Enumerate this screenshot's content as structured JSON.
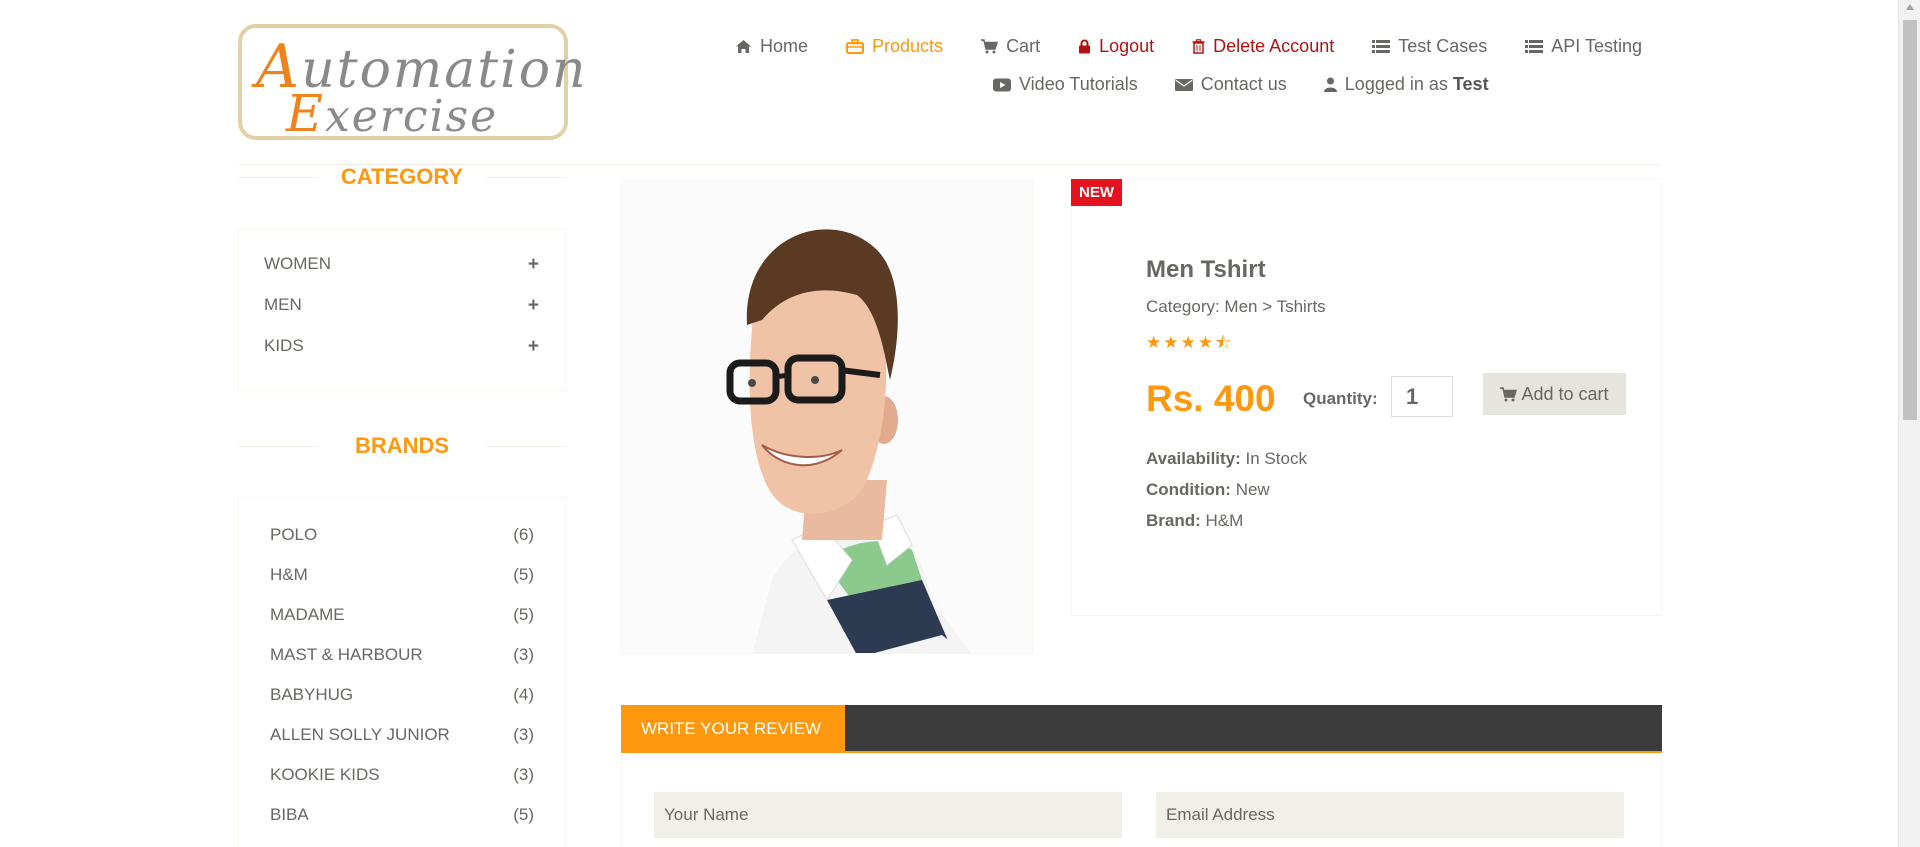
{
  "logo": {
    "line1_cap": "A",
    "line1_rest": "utomation",
    "line2_cap": "E",
    "line2_rest": "xercise"
  },
  "nav": {
    "home": "Home",
    "products": "Products",
    "cart": "Cart",
    "logout": "Logout",
    "delete_account": "Delete Account",
    "test_cases": "Test Cases",
    "api_testing": "API Testing",
    "video_tutorials": "Video Tutorials",
    "contact_us": "Contact us",
    "logged_in_prefix": "Logged in as",
    "logged_in_user": "Test"
  },
  "sidebar": {
    "category_title": "CATEGORY",
    "categories": [
      {
        "label": "WOMEN",
        "icon": "plus-icon",
        "glyph": "+"
      },
      {
        "label": "MEN",
        "icon": "plus-icon",
        "glyph": "+"
      },
      {
        "label": "KIDS",
        "icon": "plus-icon",
        "glyph": "+"
      }
    ],
    "brands_title": "BRANDS",
    "brands": [
      {
        "name": "POLO",
        "count": "(6)"
      },
      {
        "name": "H&M",
        "count": "(5)"
      },
      {
        "name": "MADAME",
        "count": "(5)"
      },
      {
        "name": "MAST & HARBOUR",
        "count": "(3)"
      },
      {
        "name": "BABYHUG",
        "count": "(4)"
      },
      {
        "name": "ALLEN SOLLY JUNIOR",
        "count": "(3)"
      },
      {
        "name": "KOOKIE KIDS",
        "count": "(3)"
      },
      {
        "name": "BIBA",
        "count": "(5)"
      }
    ]
  },
  "product": {
    "badge": "NEW",
    "name": "Men Tshirt",
    "category": "Category: Men > Tshirts",
    "rating": 4.5,
    "stars": "★★★★⯪",
    "price": "Rs. 400",
    "quantity_label": "Quantity:",
    "quantity_value": "1",
    "add_to_cart": "Add to cart",
    "availability_label": "Availability:",
    "availability": "In Stock",
    "condition_label": "Condition:",
    "condition": "New",
    "brand_label": "Brand:",
    "brand": "H&M"
  },
  "review": {
    "tab_label": "Write Your Review",
    "name_placeholder": "Your Name",
    "email_placeholder": "Email Address"
  },
  "colors": {
    "accent": "#FE980F",
    "danger": "#B4120F",
    "badge": "#e3141f",
    "bar": "#3c3c3c"
  }
}
